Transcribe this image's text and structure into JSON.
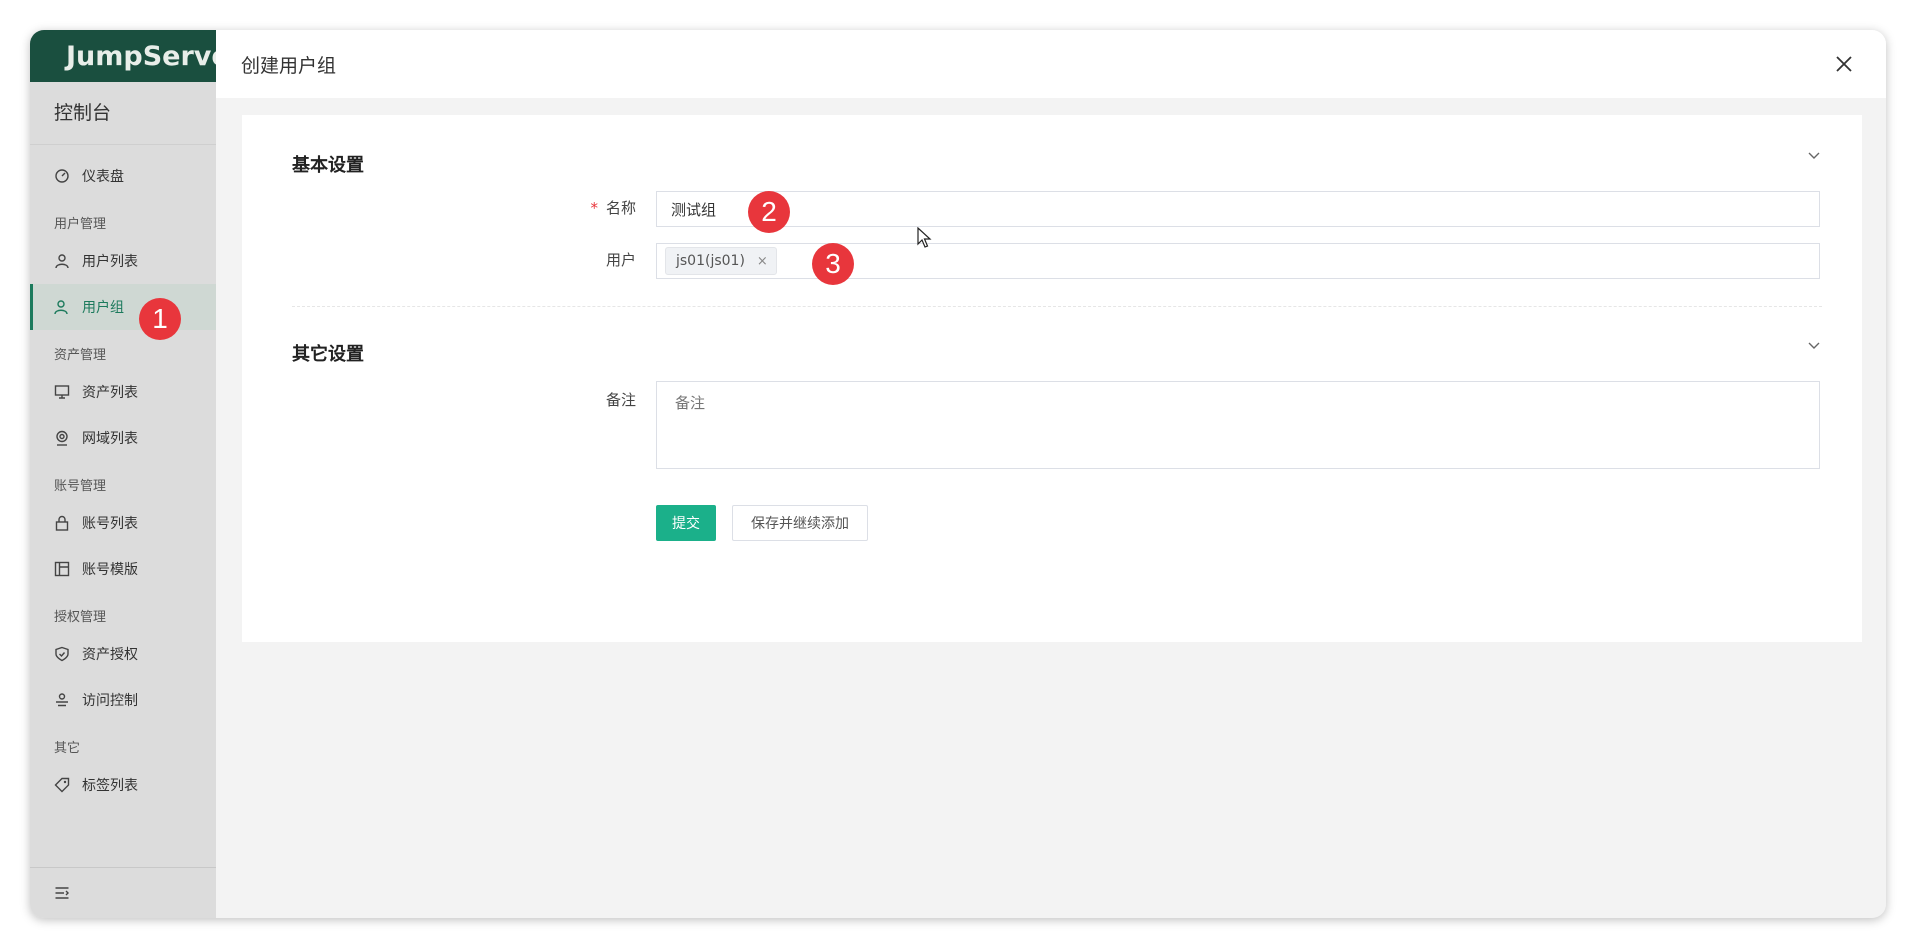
{
  "app": {
    "logo_text": "JumpServer",
    "console_title": "控制台"
  },
  "sidebar": {
    "items": [
      {
        "type": "item",
        "label": "仪表盘",
        "icon": "dashboard-icon"
      },
      {
        "type": "group",
        "label": "用户管理"
      },
      {
        "type": "item",
        "label": "用户列表",
        "icon": "user-icon"
      },
      {
        "type": "item",
        "label": "用户组",
        "icon": "user-group-icon",
        "active": true
      },
      {
        "type": "group",
        "label": "资产管理"
      },
      {
        "type": "item",
        "label": "资产列表",
        "icon": "monitor-icon"
      },
      {
        "type": "item",
        "label": "网域列表",
        "icon": "location-icon"
      },
      {
        "type": "group",
        "label": "账号管理"
      },
      {
        "type": "item",
        "label": "账号列表",
        "icon": "lock-icon"
      },
      {
        "type": "item",
        "label": "账号模版",
        "icon": "template-icon"
      },
      {
        "type": "group",
        "label": "授权管理"
      },
      {
        "type": "item",
        "label": "资产授权",
        "icon": "shield-icon"
      },
      {
        "type": "item",
        "label": "访问控制",
        "icon": "access-control-icon"
      },
      {
        "type": "group",
        "label": "其它"
      },
      {
        "type": "item",
        "label": "标签列表",
        "icon": "tag-icon"
      }
    ],
    "footer_icon": "collapse-menu-icon"
  },
  "drawer": {
    "title": "创建用户组",
    "close_icon": "close-icon"
  },
  "form": {
    "basic_section_title": "基本设置",
    "name_label": "名称",
    "name_required_mark": "*",
    "name_value": "测试组",
    "users_label": "用户",
    "users_selected": [
      "js01(js01)"
    ],
    "tag_remove_glyph": "×",
    "other_section_title": "其它设置",
    "comment_label": "备注",
    "comment_placeholder": "备注",
    "submit_label": "提交",
    "save_continue_label": "保存并继续添加"
  },
  "callouts": [
    "1",
    "2",
    "3"
  ],
  "colors": {
    "accent": "#1bb08a",
    "logo_bar": "#1a4f3f",
    "badge": "#e8363c"
  }
}
